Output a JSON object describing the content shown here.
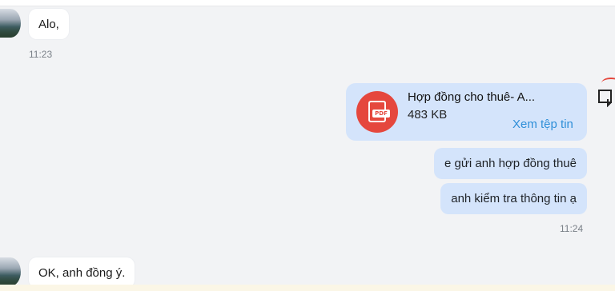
{
  "messages_in": [
    {
      "text": "Alo,",
      "time": "11:23"
    },
    {
      "text": "OK, anh đồng ý."
    }
  ],
  "file_message": {
    "file_name": "Hợp đồng cho thuê- A...",
    "file_size": "483 KB",
    "view_label": "Xem tệp tin",
    "file_type": "PDF",
    "icon": "pdf-file-icon",
    "accent_color": "#e5473d"
  },
  "messages_out": [
    {
      "text": "e gửi anh hợp đồng thuê"
    },
    {
      "text": "anh kiểm tra thông tin ạ"
    }
  ],
  "out_time": "11:24",
  "colors": {
    "background": "#f2f3f5",
    "incoming_bubble": "#ffffff",
    "outgoing_bubble": "#d4e4fb",
    "link": "#2f8fd8"
  }
}
